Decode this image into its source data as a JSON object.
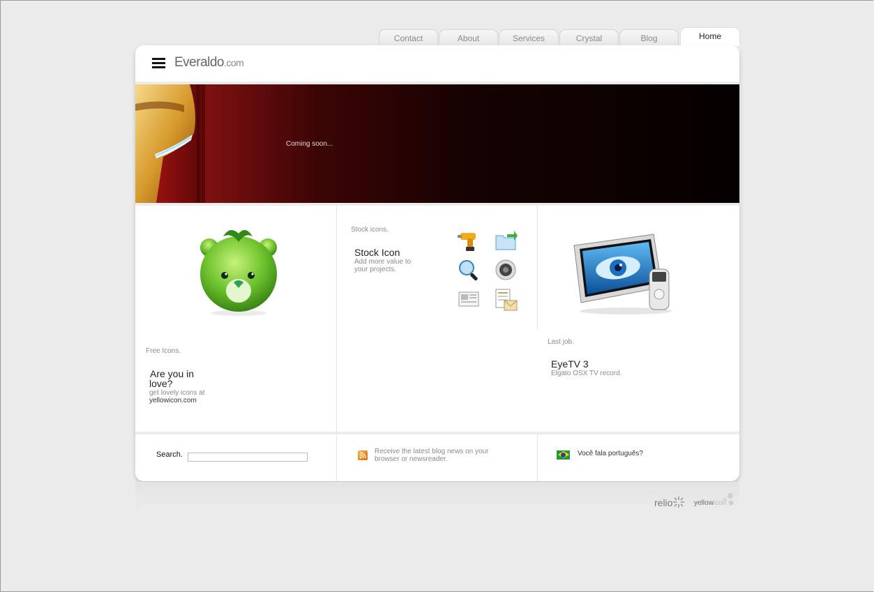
{
  "nav": {
    "tabs": [
      {
        "label": "Contact"
      },
      {
        "label": "About"
      },
      {
        "label": "Services"
      },
      {
        "label": "Crystal"
      },
      {
        "label": "Blog"
      },
      {
        "label": "Home",
        "active": true
      }
    ]
  },
  "header": {
    "logo_main": "Everaldo",
    "logo_suffix": ".com"
  },
  "banner": {
    "text": "Coming soon..."
  },
  "columns": {
    "free": {
      "label": "Free Icons.",
      "title_line1": "Are you in",
      "title_line2": "love?",
      "desc": "get lovely icons at",
      "link": "yellowicon.com"
    },
    "stock": {
      "label": "Stock icons.",
      "title": "Stock Icon",
      "desc_line1": "Add more value to",
      "desc_line2": "your projects."
    },
    "lastjob": {
      "label": "Last job.",
      "title": "EyeTV 3",
      "desc": "Elgato OSX TV record."
    }
  },
  "footer": {
    "search_label": "Search.",
    "search_value": "",
    "rss_line1": "Receive the latest blog news on your",
    "rss_line2": "browser or newsreader.",
    "portuguese": "Você fala português?"
  },
  "credits": {
    "relio": "relio",
    "yellowicon_a": "yellow",
    "yellowicon_b": "icon"
  },
  "colors": {
    "accent_orange": "#f29a1a",
    "banner_red": "#7e1010",
    "bear_green": "#6cc12c"
  }
}
